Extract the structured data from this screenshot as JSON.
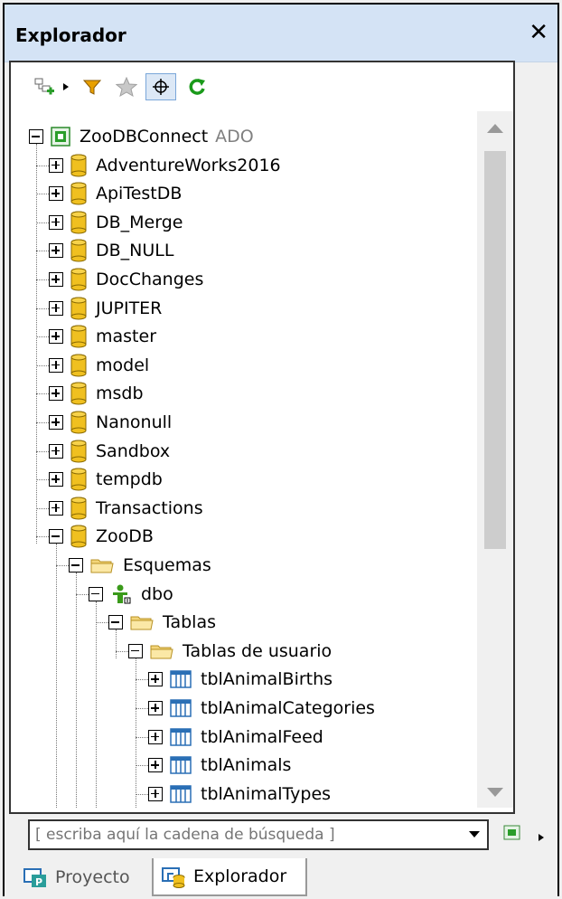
{
  "window": {
    "title": "Explorador",
    "close_label": "✕"
  },
  "toolbar": {
    "buttons": [
      "add-connection",
      "dropdown",
      "filter",
      "favorites",
      "locate",
      "refresh"
    ]
  },
  "tree": {
    "root": {
      "label": "ZooDBConnect",
      "suffix": "ADO"
    },
    "databases": [
      "AdventureWorks2016",
      "ApiTestDB",
      "DB_Merge",
      "DB_NULL",
      "DocChanges",
      "JUPITER",
      "master",
      "model",
      "msdb",
      "Nanonull",
      "Sandbox",
      "tempdb",
      "Transactions",
      "ZooDB"
    ],
    "schemas_label": "Esquemas",
    "schema": "dbo",
    "tables_label": "Tablas",
    "user_tables_label": "Tablas de usuario",
    "tables": [
      "tblAnimalBirths",
      "tblAnimalCategories",
      "tblAnimalFeed",
      "tblAnimals",
      "tblAnimalTypes"
    ]
  },
  "search": {
    "placeholder": "[ escriba aquí la cadena de búsqueda ]"
  },
  "tabs": [
    {
      "label": "Proyecto"
    },
    {
      "label": "Explorador"
    }
  ],
  "colors": {
    "db": "#f0c020",
    "table": "#2a6fb5",
    "titlebar": "#d4e3f5"
  }
}
